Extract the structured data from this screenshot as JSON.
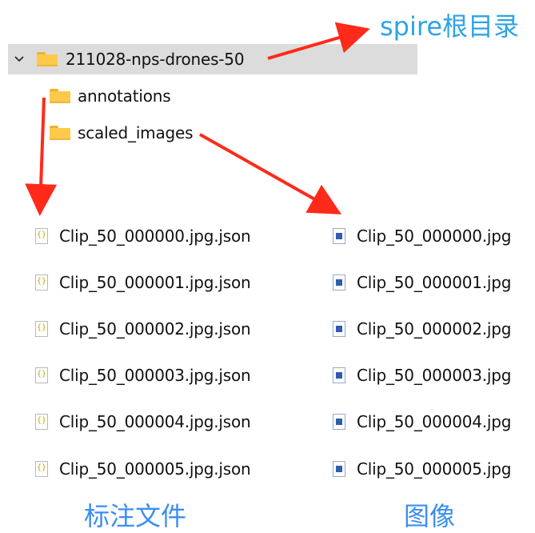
{
  "top_label": "spire根目录",
  "tree": {
    "root_folder": "211028-nps-drones-50",
    "children": [
      "annotations",
      "scaled_images"
    ]
  },
  "json_files": [
    "Clip_50_000000.jpg.json",
    "Clip_50_000001.jpg.json",
    "Clip_50_000002.jpg.json",
    "Clip_50_000003.jpg.json",
    "Clip_50_000004.jpg.json",
    "Clip_50_000005.jpg.json"
  ],
  "image_files": [
    "Clip_50_000000.jpg",
    "Clip_50_000001.jpg",
    "Clip_50_000002.jpg",
    "Clip_50_000003.jpg",
    "Clip_50_000004.jpg",
    "Clip_50_000005.jpg"
  ],
  "bottom_labels": {
    "annotations": "标注文件",
    "images": "图像"
  },
  "colors": {
    "arrow": "#ff2a1a",
    "label_blue": "#3a8ef0",
    "folder": "#ffc94a",
    "selection": "#dcdcdc"
  },
  "icons": {
    "expand": "chevron-down-icon",
    "folder": "folder-icon",
    "json_file": "json-file-icon",
    "image_file": "image-file-icon"
  }
}
